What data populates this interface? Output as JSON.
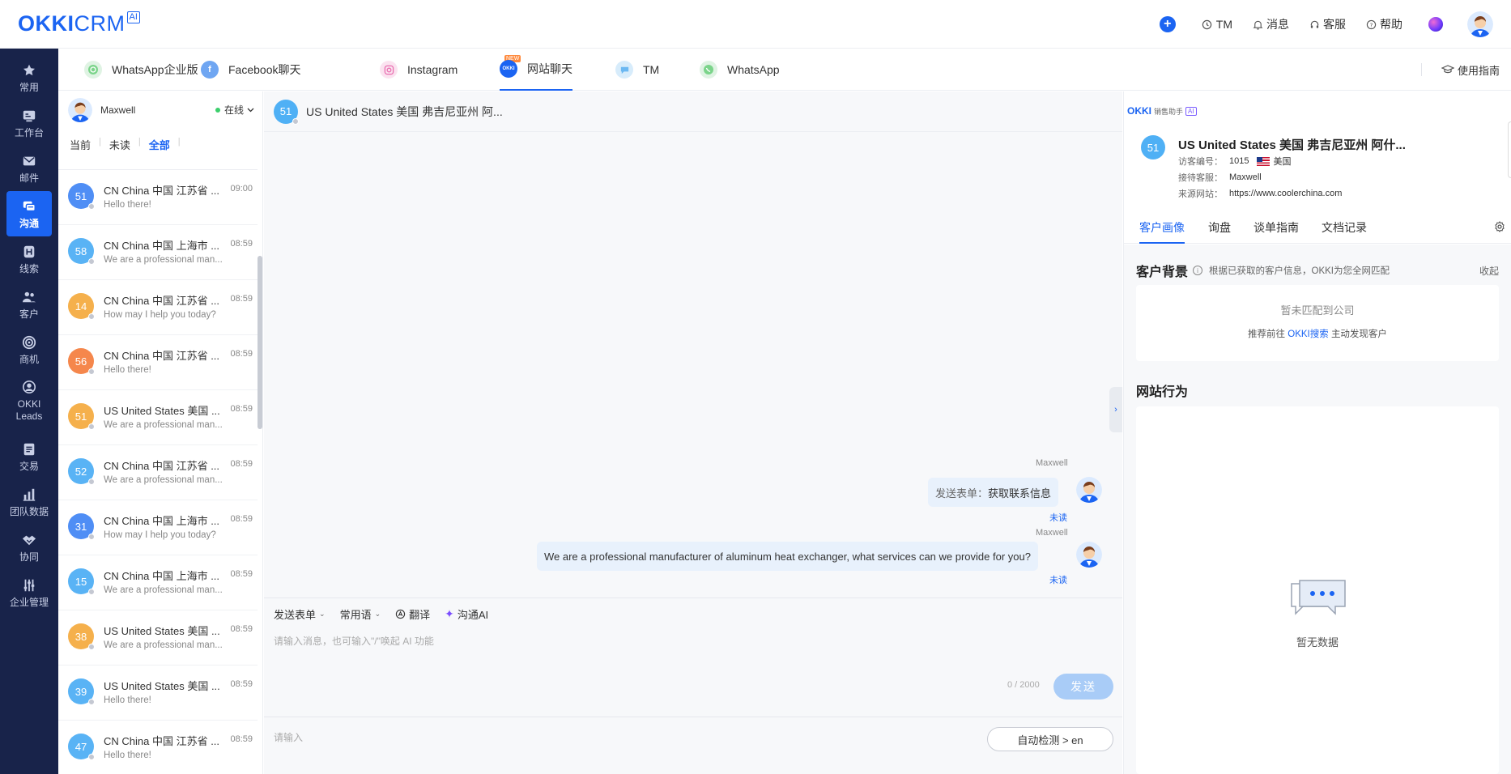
{
  "header": {
    "logo_okki": "OKKI",
    "logo_crm": "CRM",
    "logo_ai": "AI",
    "items": [
      {
        "icon": "clock-icon",
        "label": "TM"
      },
      {
        "icon": "bell-icon",
        "label": "消息"
      },
      {
        "icon": "headset-icon",
        "label": "客服"
      },
      {
        "icon": "help-icon",
        "label": "帮助"
      }
    ]
  },
  "nav": [
    {
      "icon": "star-icon",
      "label": "常用"
    },
    {
      "icon": "workbench-icon",
      "label": "工作台"
    },
    {
      "icon": "mail-icon",
      "label": "邮件"
    },
    {
      "icon": "chat-icon",
      "label": "沟通",
      "active": true
    },
    {
      "icon": "leads-icon",
      "label": "线索"
    },
    {
      "icon": "customer-icon",
      "label": "客户"
    },
    {
      "icon": "target-icon",
      "label": "商机"
    },
    {
      "icon": "okki-leads-icon",
      "label": "OKKI Leads"
    },
    {
      "icon": "deal-icon",
      "label": "交易"
    },
    {
      "icon": "bar-chart-icon",
      "label": "团队数据"
    },
    {
      "icon": "handshake-icon",
      "label": "协同"
    },
    {
      "icon": "settings-sliders-icon",
      "label": "企业管理"
    }
  ],
  "channels": [
    {
      "label": "WhatsApp企业版",
      "icon": "whatsapp-business-icon",
      "color": "#7bd48a"
    },
    {
      "label": "Facebook聊天",
      "icon": "facebook-icon",
      "color": "#6fa6f2"
    },
    {
      "label": "Instagram",
      "icon": "instagram-icon",
      "color": "#e96fb0",
      "badge": "NEW"
    },
    {
      "label": "网站聊天",
      "icon": "okki-chat-icon",
      "color": "#1b64f2",
      "active": true
    },
    {
      "label": "TM",
      "icon": "tm-icon",
      "color": "#6bb8f2"
    },
    {
      "label": "WhatsApp",
      "icon": "whatsapp-icon",
      "color": "#7bd48a"
    }
  ],
  "guide_label": "使用指南",
  "agent": {
    "name": "Maxwell",
    "status": "在线"
  },
  "filters": [
    "当前",
    "未读",
    "全部"
  ],
  "conversations": [
    {
      "num": "51",
      "title": "CN China 中国 江苏省 ...",
      "time": "09:00",
      "preview": "Hello there!",
      "color": "#4f8ef5"
    },
    {
      "num": "58",
      "title": "CN China 中国 上海市 ...",
      "time": "08:59",
      "preview": "We are a professional man...",
      "color": "#59b3f5"
    },
    {
      "num": "14",
      "title": "CN China 中国 江苏省 ...",
      "time": "08:59",
      "preview": "How may I help you today?",
      "color": "#f5b04c"
    },
    {
      "num": "56",
      "title": "CN China 中国 江苏省 ...",
      "time": "08:59",
      "preview": "Hello there!",
      "color": "#f5874c"
    },
    {
      "num": "51",
      "title": "US United States 美国 ...",
      "time": "08:59",
      "preview": "We are a professional man...",
      "color": "#f5b04c"
    },
    {
      "num": "52",
      "title": "CN China 中国 江苏省 ...",
      "time": "08:59",
      "preview": "We are a professional man...",
      "color": "#59b3f5"
    },
    {
      "num": "31",
      "title": "CN China 中国 上海市 ...",
      "time": "08:59",
      "preview": "How may I help you today?",
      "color": "#4f8ef5"
    },
    {
      "num": "15",
      "title": "CN China 中国 上海市 ...",
      "time": "08:59",
      "preview": "We are a professional man...",
      "color": "#59b3f5"
    },
    {
      "num": "38",
      "title": "US United States 美国 ...",
      "time": "08:59",
      "preview": "We are a professional man...",
      "color": "#f5b04c"
    },
    {
      "num": "39",
      "title": "US United States 美国 ...",
      "time": "08:59",
      "preview": "Hello there!",
      "color": "#59b3f5"
    },
    {
      "num": "47",
      "title": "CN China 中国 江苏省 ...",
      "time": "08:59",
      "preview": "Hello there!",
      "color": "#59b3f5"
    }
  ],
  "chat": {
    "visitor_num": "51",
    "title": "US United States 美国 弗吉尼亚州 阿...",
    "messages": [
      {
        "sender": "Maxwell",
        "label": "发送表单：",
        "text": "获取联系信息",
        "status": "未读"
      },
      {
        "sender": "Maxwell",
        "text": "We are a professional manufacturer of aluminum heat exchanger, what services can we provide for you?",
        "status": "未读"
      }
    ],
    "tools": [
      "发送表单",
      "常用语",
      "翻译",
      "沟通AI"
    ],
    "input_placeholder": "请输入消息，也可输入\"/\"唤起 AI 功能",
    "counter": "0 / 2000",
    "send_label": "发送",
    "translate_placeholder": "请输入",
    "auto_detect": "自动检测 > en"
  },
  "right": {
    "logo_okki": "OKKI",
    "logo_text": "销售助手",
    "logo_ai": "AI",
    "visitor_num": "51",
    "title": "US United States 美国 弗吉尼亚州 阿什...",
    "visitor_id_label": "访客编号：",
    "visitor_id": "1015",
    "country": "美国",
    "agent_label": "接待客服：",
    "agent": "Maxwell",
    "source_label": "来源网站：",
    "source": "https://www.coolerchina.com",
    "tabs": [
      "客户画像",
      "询盘",
      "谈单指南",
      "文档记录"
    ],
    "bg_title": "客户背景",
    "bg_desc": "根据已获取的客户信息，OKKI为您全网匹配",
    "collapse": "收起",
    "no_match": "暂未匹配到公司",
    "recommend_pre": "推荐前往",
    "recommend_link": "OKKI搜索",
    "recommend_post": "主动发现客户",
    "web_title": "网站行为",
    "empty": "暂无数据"
  }
}
